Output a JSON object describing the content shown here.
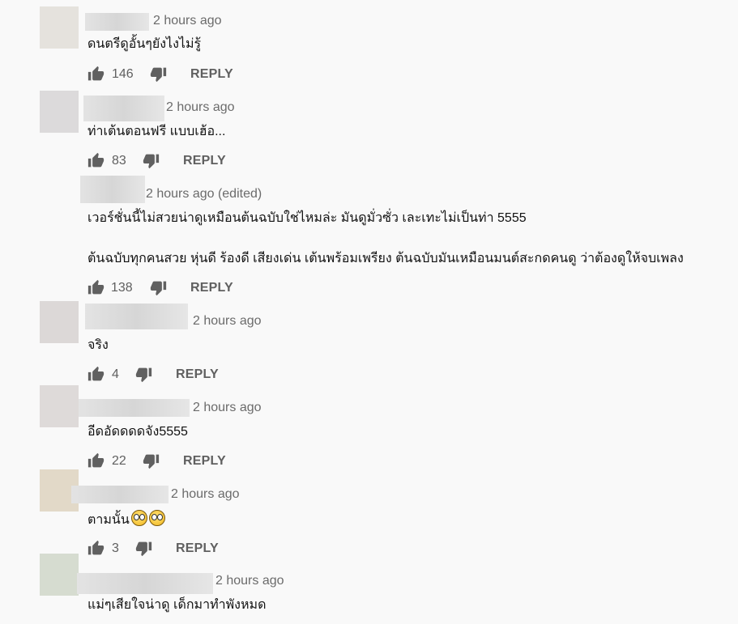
{
  "comments": [
    {
      "time": "2 hours ago",
      "text": "ดนตรีดูอั้นๆยังไงไม่รู้",
      "likes": "146",
      "reply": "REPLY",
      "avatar_color": "#e5e2dd"
    },
    {
      "time": "2 hours ago",
      "text": "ท่าเต้นตอนฟรี แบบเฮ้อ...",
      "likes": "83",
      "reply": "REPLY",
      "avatar_color": "#dcdadb"
    },
    {
      "time": "2 hours ago (edited)",
      "text_line1": "เวอร์ชั่นนี้ไม่สวยน่าดูเหมือนต้นฉบับใช่ไหมล่ะ มันดูมั่วซั่ว เละเทะไม่เป็นท่า 5555",
      "text_line2": "ต้นฉบับทุกคนสวย หุ่นดี ร้องดี เสียงเด่น เต้นพร้อมเพรียง ต้นฉบับมันเหมือนมนต์สะกดคนดู ว่าต้องดูให้จบเพลง",
      "likes": "138",
      "reply": "REPLY"
    },
    {
      "time": "2 hours ago",
      "text": "จริง",
      "likes": "4",
      "reply": "REPLY",
      "avatar_color": "#dcd8d7"
    },
    {
      "time": "2 hours ago",
      "text": "อีดอัดดดดจัง5555",
      "likes": "22",
      "reply": "REPLY",
      "avatar_color": "#dedad9"
    },
    {
      "time": "2 hours ago",
      "text": "ตามนั้น",
      "likes": "3",
      "reply": "REPLY",
      "avatar_color": "#e2d9c8"
    },
    {
      "time": "2 hours ago",
      "text": "แม่ๆเสียใจน่าดู เด็กมาทำพังหมด",
      "avatar_color": "#d6dcd0"
    }
  ],
  "icons": {
    "like": "thumbs-up-icon",
    "dislike": "thumbs-down-icon",
    "emoji": "face-with-rolling-eyes-icon"
  }
}
